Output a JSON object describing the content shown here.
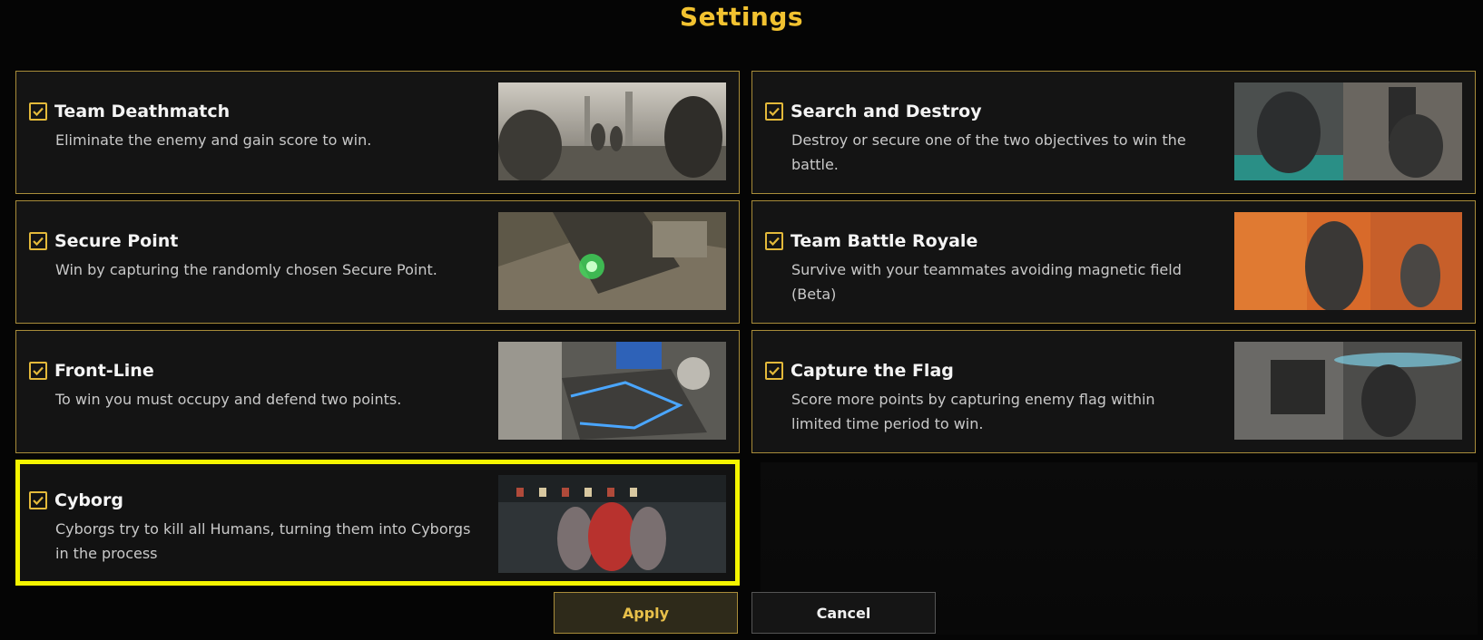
{
  "title": "Settings",
  "modes": [
    {
      "title": "Team Deathmatch",
      "description": "Eliminate the enemy and gain score to win.",
      "checked": true,
      "image": "team-deathmatch-thumbnail"
    },
    {
      "title": "Search and Destroy",
      "description": "Destroy or secure one of the two objectives to win the battle.",
      "checked": true,
      "image": "search-and-destroy-thumbnail"
    },
    {
      "title": "Secure Point",
      "description": "Win by capturing the randomly chosen Secure Point.",
      "checked": true,
      "image": "secure-point-thumbnail"
    },
    {
      "title": "Team Battle Royale",
      "description": "Survive with your teammates avoiding magnetic field (Beta)",
      "checked": true,
      "image": "team-battle-royale-thumbnail"
    },
    {
      "title": "Front-Line",
      "description": "To win you must occupy and defend two points.",
      "checked": true,
      "image": "front-line-thumbnail"
    },
    {
      "title": "Capture the Flag",
      "description": "Score more points by capturing enemy flag within limited time period to win.",
      "checked": true,
      "image": "capture-the-flag-thumbnail"
    },
    {
      "title": "Cyborg",
      "description": "Cyborgs try to kill all Humans, turning them into Cyborgs in the process",
      "checked": true,
      "image": "cyborg-thumbnail",
      "highlighted": true
    }
  ],
  "buttons": {
    "apply": "Apply",
    "cancel": "Cancel"
  },
  "colors": {
    "accent": "#f2c230",
    "border": "#a88c3a",
    "highlight": "#f5f500"
  }
}
